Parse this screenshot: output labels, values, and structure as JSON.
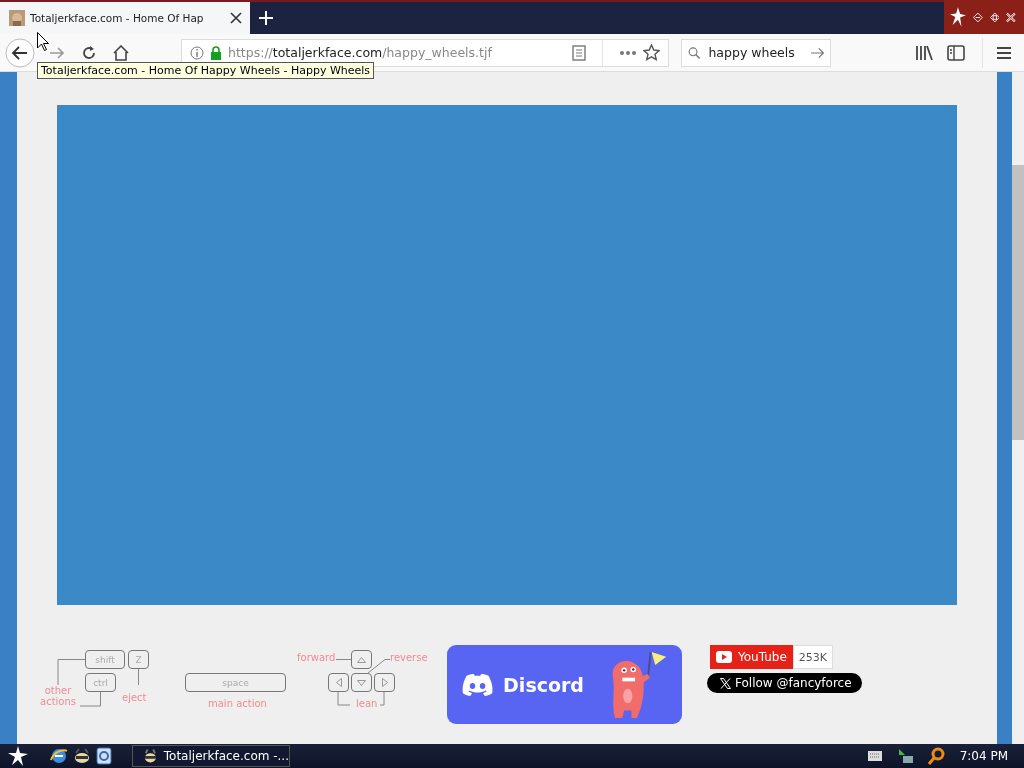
{
  "browser": {
    "tabs": [
      {
        "title": "Totaljerkface.com - Home Of Hap",
        "selected": true
      }
    ],
    "address": {
      "scheme": "https://",
      "host": "totaljerkface.com",
      "path": "/happy_wheels.tjf"
    },
    "search": {
      "value": "happy wheels"
    },
    "tooltip": "Totaljerkface.com - Home Of Happy Wheels - Happy Wheels"
  },
  "page": {
    "keys": [
      "shift",
      "Z",
      "ctrl",
      "space"
    ],
    "key_labels": [
      "other actions",
      "eject",
      "main action",
      "forward",
      "reverse",
      "lean"
    ],
    "discord": {
      "label": "Discord"
    },
    "youtube": {
      "label": "YouTube",
      "count": "253K"
    },
    "x_follow": {
      "label": "Follow @fancyforce"
    }
  },
  "taskbar": {
    "tasks": [
      {
        "title": "Totaljerkface.com -...",
        "selected": false
      }
    ],
    "clock": "7:04 PM"
  }
}
